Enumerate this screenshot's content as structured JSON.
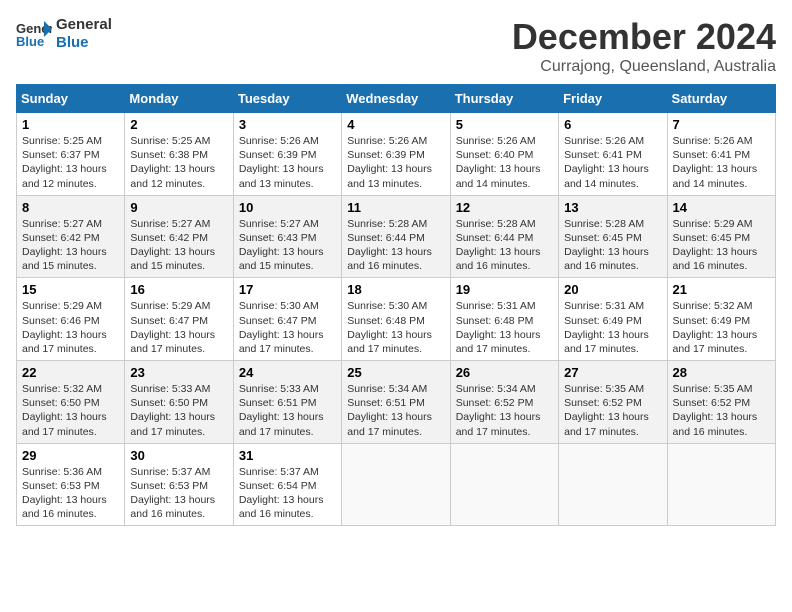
{
  "logo": {
    "line1": "General",
    "line2": "Blue"
  },
  "title": "December 2024",
  "subtitle": "Currajong, Queensland, Australia",
  "days_of_week": [
    "Sunday",
    "Monday",
    "Tuesday",
    "Wednesday",
    "Thursday",
    "Friday",
    "Saturday"
  ],
  "weeks": [
    [
      {
        "day": "1",
        "sunrise": "5:25 AM",
        "sunset": "6:37 PM",
        "daylight": "13 hours and 12 minutes."
      },
      {
        "day": "2",
        "sunrise": "5:25 AM",
        "sunset": "6:38 PM",
        "daylight": "13 hours and 12 minutes."
      },
      {
        "day": "3",
        "sunrise": "5:26 AM",
        "sunset": "6:39 PM",
        "daylight": "13 hours and 13 minutes."
      },
      {
        "day": "4",
        "sunrise": "5:26 AM",
        "sunset": "6:39 PM",
        "daylight": "13 hours and 13 minutes."
      },
      {
        "day": "5",
        "sunrise": "5:26 AM",
        "sunset": "6:40 PM",
        "daylight": "13 hours and 14 minutes."
      },
      {
        "day": "6",
        "sunrise": "5:26 AM",
        "sunset": "6:41 PM",
        "daylight": "13 hours and 14 minutes."
      },
      {
        "day": "7",
        "sunrise": "5:26 AM",
        "sunset": "6:41 PM",
        "daylight": "13 hours and 14 minutes."
      }
    ],
    [
      {
        "day": "8",
        "sunrise": "5:27 AM",
        "sunset": "6:42 PM",
        "daylight": "13 hours and 15 minutes."
      },
      {
        "day": "9",
        "sunrise": "5:27 AM",
        "sunset": "6:42 PM",
        "daylight": "13 hours and 15 minutes."
      },
      {
        "day": "10",
        "sunrise": "5:27 AM",
        "sunset": "6:43 PM",
        "daylight": "13 hours and 15 minutes."
      },
      {
        "day": "11",
        "sunrise": "5:28 AM",
        "sunset": "6:44 PM",
        "daylight": "13 hours and 16 minutes."
      },
      {
        "day": "12",
        "sunrise": "5:28 AM",
        "sunset": "6:44 PM",
        "daylight": "13 hours and 16 minutes."
      },
      {
        "day": "13",
        "sunrise": "5:28 AM",
        "sunset": "6:45 PM",
        "daylight": "13 hours and 16 minutes."
      },
      {
        "day": "14",
        "sunrise": "5:29 AM",
        "sunset": "6:45 PM",
        "daylight": "13 hours and 16 minutes."
      }
    ],
    [
      {
        "day": "15",
        "sunrise": "5:29 AM",
        "sunset": "6:46 PM",
        "daylight": "13 hours and 17 minutes."
      },
      {
        "day": "16",
        "sunrise": "5:29 AM",
        "sunset": "6:47 PM",
        "daylight": "13 hours and 17 minutes."
      },
      {
        "day": "17",
        "sunrise": "5:30 AM",
        "sunset": "6:47 PM",
        "daylight": "13 hours and 17 minutes."
      },
      {
        "day": "18",
        "sunrise": "5:30 AM",
        "sunset": "6:48 PM",
        "daylight": "13 hours and 17 minutes."
      },
      {
        "day": "19",
        "sunrise": "5:31 AM",
        "sunset": "6:48 PM",
        "daylight": "13 hours and 17 minutes."
      },
      {
        "day": "20",
        "sunrise": "5:31 AM",
        "sunset": "6:49 PM",
        "daylight": "13 hours and 17 minutes."
      },
      {
        "day": "21",
        "sunrise": "5:32 AM",
        "sunset": "6:49 PM",
        "daylight": "13 hours and 17 minutes."
      }
    ],
    [
      {
        "day": "22",
        "sunrise": "5:32 AM",
        "sunset": "6:50 PM",
        "daylight": "13 hours and 17 minutes."
      },
      {
        "day": "23",
        "sunrise": "5:33 AM",
        "sunset": "6:50 PM",
        "daylight": "13 hours and 17 minutes."
      },
      {
        "day": "24",
        "sunrise": "5:33 AM",
        "sunset": "6:51 PM",
        "daylight": "13 hours and 17 minutes."
      },
      {
        "day": "25",
        "sunrise": "5:34 AM",
        "sunset": "6:51 PM",
        "daylight": "13 hours and 17 minutes."
      },
      {
        "day": "26",
        "sunrise": "5:34 AM",
        "sunset": "6:52 PM",
        "daylight": "13 hours and 17 minutes."
      },
      {
        "day": "27",
        "sunrise": "5:35 AM",
        "sunset": "6:52 PM",
        "daylight": "13 hours and 17 minutes."
      },
      {
        "day": "28",
        "sunrise": "5:35 AM",
        "sunset": "6:52 PM",
        "daylight": "13 hours and 16 minutes."
      }
    ],
    [
      {
        "day": "29",
        "sunrise": "5:36 AM",
        "sunset": "6:53 PM",
        "daylight": "13 hours and 16 minutes."
      },
      {
        "day": "30",
        "sunrise": "5:37 AM",
        "sunset": "6:53 PM",
        "daylight": "13 hours and 16 minutes."
      },
      {
        "day": "31",
        "sunrise": "5:37 AM",
        "sunset": "6:54 PM",
        "daylight": "13 hours and 16 minutes."
      },
      null,
      null,
      null,
      null
    ]
  ]
}
